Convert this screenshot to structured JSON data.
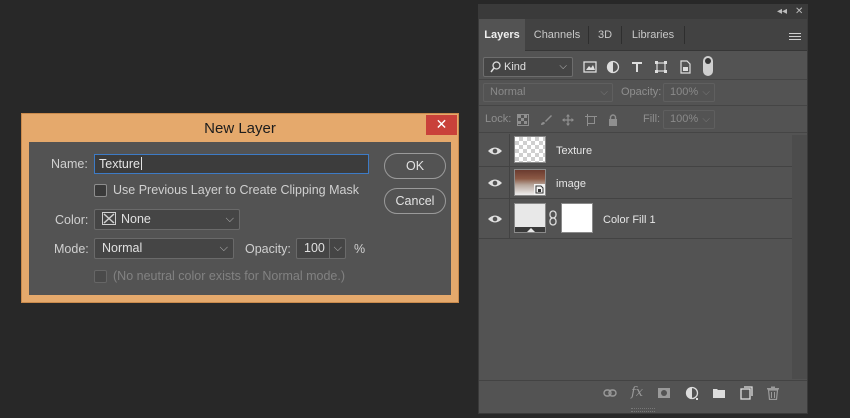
{
  "dialog": {
    "title": "New Layer",
    "close_glyph": "✕",
    "name_label": "Name:",
    "name_value": "Texture",
    "clipping_label": "Use Previous Layer to Create Clipping Mask",
    "clipping_checked": false,
    "color_label": "Color:",
    "color_value": "None",
    "mode_label": "Mode:",
    "mode_value": "Normal",
    "opacity_label": "Opacity:",
    "opacity_value": "100",
    "opacity_unit": "%",
    "neutral_label": "(No neutral color exists for Normal mode.)",
    "ok_label": "OK",
    "cancel_label": "Cancel",
    "accent_color": "#e5a96c",
    "close_color": "#c9413a"
  },
  "panel": {
    "collapse_glyph": "◂◂",
    "close_glyph": "✕",
    "tabs": [
      {
        "label": "Layers",
        "active": true
      },
      {
        "label": "Channels",
        "active": false
      },
      {
        "label": "3D",
        "active": false
      },
      {
        "label": "Libraries",
        "active": false
      }
    ],
    "filter": {
      "kind_label": "Kind",
      "icons": [
        "image-filter-icon",
        "adjustment-filter-icon",
        "type-filter-icon",
        "shape-filter-icon",
        "smart-object-filter-icon",
        "filter-toggle-icon"
      ]
    },
    "blend_mode": "Normal",
    "opacity_label": "Opacity:",
    "opacity_value": "100%",
    "lock_label": "Lock:",
    "fill_label": "Fill:",
    "fill_value": "100%",
    "layers": [
      {
        "name": "Texture",
        "visible": true,
        "thumb": "transparent"
      },
      {
        "name": "image",
        "visible": true,
        "thumb": "photo"
      },
      {
        "name": "Color Fill 1",
        "visible": true,
        "thumb": "fill-with-mask"
      }
    ],
    "footer_icons": [
      "link-layers-icon",
      "fx-icon",
      "add-mask-icon",
      "adjustment-layer-icon",
      "new-group-icon",
      "new-layer-icon",
      "trash-icon"
    ],
    "fx_text": "fx"
  }
}
